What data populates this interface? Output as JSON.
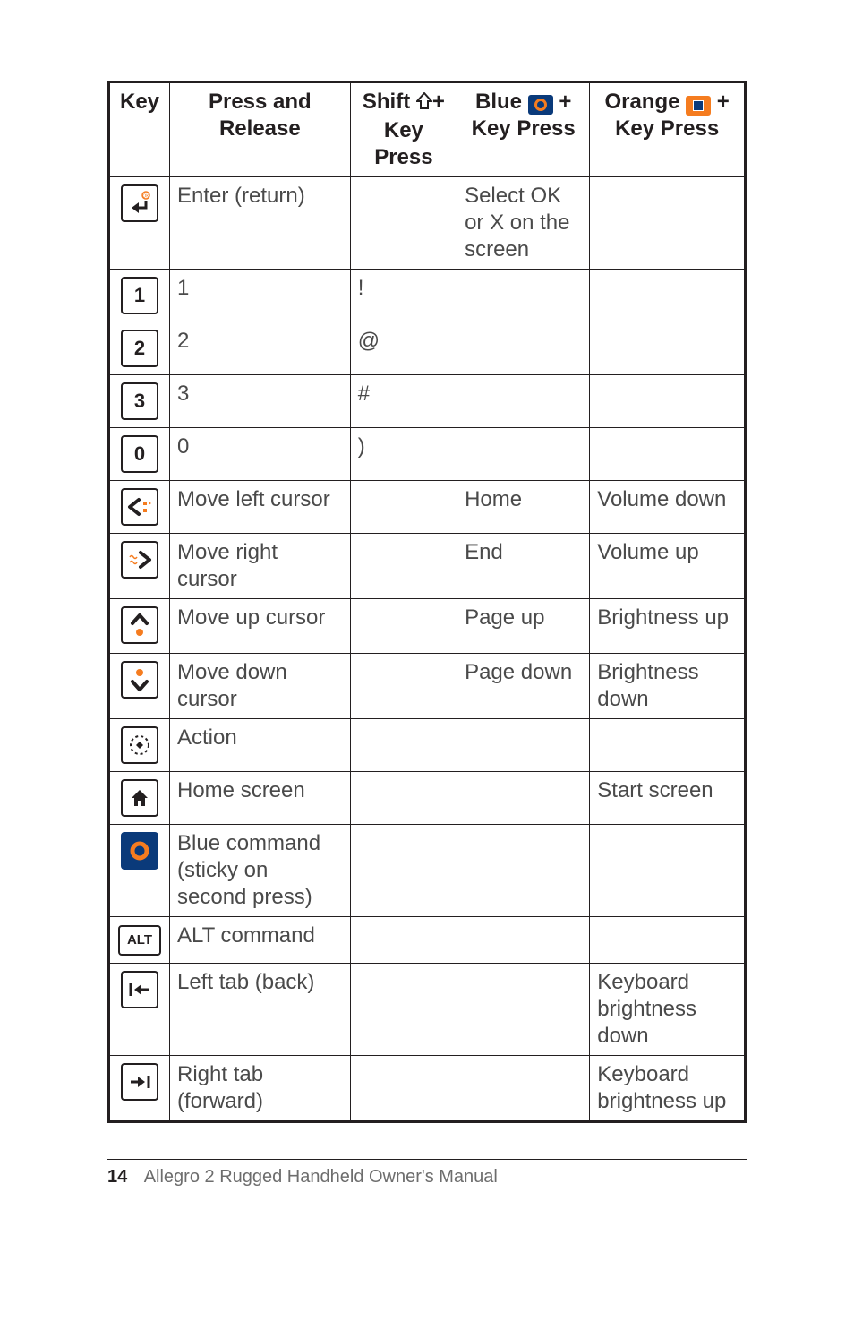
{
  "headers": {
    "key": "Key",
    "press": "Press and Release",
    "shift_pre": "Shift ",
    "shift_post": "+ Key Press",
    "blue_pre": "Blue ",
    "blue_post": " + Key Press",
    "orange_pre": "Orange ",
    "orange_post": " + Key Press"
  },
  "rows": [
    {
      "press": "Enter (return)",
      "shift": "",
      "blue": "Select OK or X on the screen",
      "orange": ""
    },
    {
      "press": "1",
      "shift": "!",
      "blue": "",
      "orange": ""
    },
    {
      "press": "2",
      "shift": "@",
      "blue": "",
      "orange": ""
    },
    {
      "press": "3",
      "shift": "#",
      "blue": "",
      "orange": ""
    },
    {
      "press": "0",
      "shift": ")",
      "blue": "",
      "orange": ""
    },
    {
      "press": "Move left cursor",
      "shift": "",
      "blue": "Home",
      "orange": "Volume down"
    },
    {
      "press": "Move right cursor",
      "shift": "",
      "blue": "End",
      "orange": "Volume up"
    },
    {
      "press": "Move up cursor",
      "shift": "",
      "blue": "Page up",
      "orange": "Brightness up"
    },
    {
      "press": "Move down cursor",
      "shift": "",
      "blue": "Page down",
      "orange": "Brightness down"
    },
    {
      "press": "Action",
      "shift": "",
      "blue": "",
      "orange": ""
    },
    {
      "press": "Home screen",
      "shift": "",
      "blue": "",
      "orange": "Start screen"
    },
    {
      "press": "Blue command (sticky on second press)",
      "shift": "",
      "blue": "",
      "orange": ""
    },
    {
      "press": "ALT command",
      "shift": "",
      "blue": "",
      "orange": ""
    },
    {
      "press": "Left tab (back)",
      "shift": "",
      "blue": "",
      "orange": "Keyboard brightness down"
    },
    {
      "press": "Right tab (forward)",
      "shift": "",
      "blue": "",
      "orange": "Keyboard brightness up"
    }
  ],
  "keycaps": {
    "k1": "1",
    "k2": "2",
    "k3": "3",
    "k0": "0",
    "alt": "ALT"
  },
  "footer": {
    "page": "14",
    "title": "Allegro 2 Rugged Handheld Owner's Manual"
  }
}
